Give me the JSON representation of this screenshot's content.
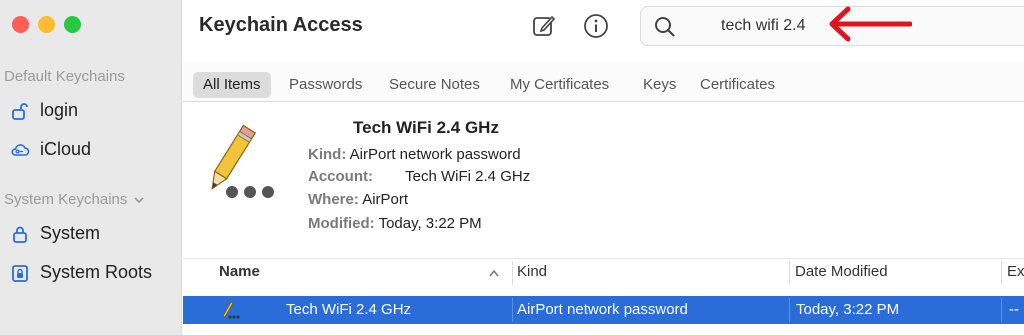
{
  "sidebar": {
    "default_section": "Default Keychains",
    "system_section": "System Keychains",
    "items": [
      {
        "label": "login",
        "icon": "unlocked-padlock-icon"
      },
      {
        "label": "iCloud",
        "icon": "cloud-key-icon"
      },
      {
        "label": "System",
        "icon": "padlock-icon"
      },
      {
        "label": "System Roots",
        "icon": "locked-cabinet-icon"
      }
    ]
  },
  "toolbar": {
    "title": "Keychain Access",
    "new_icon": "compose-icon",
    "info_icon": "info-icon",
    "search_value": "tech wifi 2.4"
  },
  "tabs": [
    "All Items",
    "Passwords",
    "Secure Notes",
    "My Certificates",
    "Keys",
    "Certificates"
  ],
  "detail": {
    "name": "Tech WiFi 2.4 GHz",
    "kind_label": "Kind:",
    "kind_value": "AirPort network password",
    "account_label": "Account:",
    "account_value": "Tech WiFi 2.4 GHz",
    "where_label": "Where:",
    "where_value": "AirPort",
    "modified_label": "Modified:",
    "modified_value": "Today, 3:22 PM"
  },
  "table": {
    "columns": [
      "Name",
      "Kind",
      "Date Modified",
      "Ex"
    ],
    "rows": [
      {
        "name": "Tech WiFi 2.4 GHz",
        "kind": "AirPort network password",
        "date": "Today, 3:22 PM",
        "expires": "--"
      }
    ]
  },
  "colors": {
    "selection": "#2a6cd8",
    "annotation_arrow": "#e0141e"
  }
}
